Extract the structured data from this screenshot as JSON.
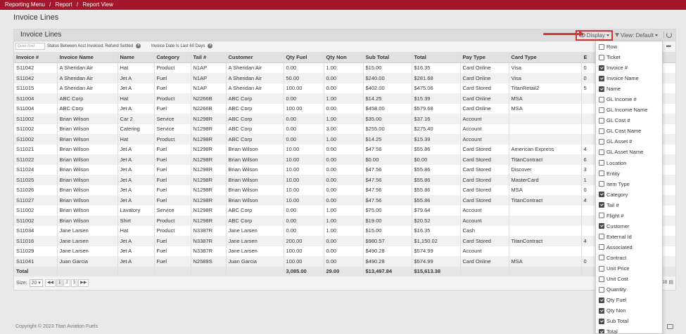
{
  "breadcrumb": [
    "Reporting Menu",
    "/",
    "Report",
    "/",
    "Report View"
  ],
  "page_title": "Invoice Lines",
  "panel": {
    "title": "Invoice Lines",
    "display_label": "Display",
    "view_label": "View: Default"
  },
  "quickfind_placeholder": "Quick Find",
  "filters": [
    "Status Between Acct Invoiced; Refund Settled",
    "Invoice Date Is Last 60 Days"
  ],
  "columns": [
    "Invoice #",
    "Invoice Name",
    "Name",
    "Category",
    "Tail #",
    "Customer",
    "Qty Fuel",
    "Qty Non",
    "Sub Total",
    "Total",
    "Pay Type",
    "Card Type",
    "E"
  ],
  "rows": [
    [
      "S11042",
      "A Sheridan Air",
      "Hat",
      "Product",
      "N1AP",
      "A Sheridan Air",
      "0.00",
      "1.00",
      "$15.00",
      "$16.35",
      "Card Online",
      "Visa",
      "0"
    ],
    [
      "S11042",
      "A Sheridan Air",
      "Jet A",
      "Fuel",
      "N1AP",
      "A Sheridan Air",
      "50.00",
      "0.00",
      "$240.00",
      "$281.68",
      "Card Online",
      "Visa",
      "0"
    ],
    [
      "S11015",
      "A Sheridan Air",
      "Jet A",
      "Fuel",
      "N1AP",
      "A Sheridan Air",
      "100.00",
      "0.00",
      "$402.00",
      "$475.06",
      "Card Stored",
      "TitanRetail2",
      "5"
    ],
    [
      "S11004",
      "ABC Corp",
      "Hat",
      "Product",
      "N2266B",
      "ABC Corp",
      "0.00",
      "1.00",
      "$14.25",
      "$15.39",
      "Card Online",
      "MSA",
      ""
    ],
    [
      "S11004",
      "ABC Corp",
      "Jet A",
      "Fuel",
      "N2266B",
      "ABC Corp",
      "100.00",
      "0.00",
      "$458.00",
      "$579.68",
      "Card Online",
      "MSA",
      ""
    ],
    [
      "S11002",
      "Brian Wilson",
      "Car 2",
      "Service",
      "N1298R",
      "ABC Corp",
      "0.00",
      "1.00",
      "$35.00",
      "$37.16",
      "Account",
      "",
      ""
    ],
    [
      "S11002",
      "Brian Wilson",
      "Catering",
      "Service",
      "N1298R",
      "ABC Corp",
      "0.00",
      "3.00",
      "$255.00",
      "$275.40",
      "Account",
      "",
      ""
    ],
    [
      "S11002",
      "Brian Wilson",
      "Hat",
      "Product",
      "N1298R",
      "ABC Corp",
      "0.00",
      "1.00",
      "$14.25",
      "$15.39",
      "Account",
      "",
      ""
    ],
    [
      "S11021",
      "Brian Wilson",
      "Jet A",
      "Fuel",
      "N1298R",
      "Brian Wilson",
      "10.00",
      "0.00",
      "$47.56",
      "$55.86",
      "Card Stored",
      "American Express",
      "4"
    ],
    [
      "S11022",
      "Brian Wilson",
      "Jet A",
      "Fuel",
      "N1298R",
      "Brian Wilson",
      "10.00",
      "0.00",
      "$0.00",
      "$0.00",
      "Card Stored",
      "TitanContract",
      "6"
    ],
    [
      "S11024",
      "Brian Wilson",
      "Jet A",
      "Fuel",
      "N1298R",
      "Brian Wilson",
      "10.00",
      "0.00",
      "$47.56",
      "$55.86",
      "Card Stored",
      "Discover",
      "3"
    ],
    [
      "S11025",
      "Brian Wilson",
      "Jet A",
      "Fuel",
      "N1298R",
      "Brian Wilson",
      "10.00",
      "0.00",
      "$47.56",
      "$55.86",
      "Card Stored",
      "MasterCard",
      "1"
    ],
    [
      "S11026",
      "Brian Wilson",
      "Jet A",
      "Fuel",
      "N1298R",
      "Brian Wilson",
      "10.00",
      "0.00",
      "$47.56",
      "$55.86",
      "Card Stored",
      "MSA",
      "0"
    ],
    [
      "S11027",
      "Brian Wilson",
      "Jet A",
      "Fuel",
      "N1298R",
      "Brian Wilson",
      "10.00",
      "0.00",
      "$47.56",
      "$55.86",
      "Card Stored",
      "TitanContract",
      "4"
    ],
    [
      "S11002",
      "Brian Wilson",
      "Lavatory",
      "Service",
      "N1298R",
      "ABC Corp",
      "0.00",
      "1.00",
      "$75.00",
      "$79.64",
      "Account",
      "",
      ""
    ],
    [
      "S11002",
      "Brian Wilson",
      "Shirt",
      "Product",
      "N1298R",
      "ABC Corp",
      "0.00",
      "1.00",
      "$19.00",
      "$20.52",
      "Account",
      "",
      ""
    ],
    [
      "S11034",
      "Jane Larsen",
      "Hat",
      "Product",
      "N3387R",
      "Jane Larsen",
      "0.00",
      "1.00",
      "$15.00",
      "$16.35",
      "Cash",
      "",
      ""
    ],
    [
      "S11016",
      "Jane Larsen",
      "Jet A",
      "Fuel",
      "N3387R",
      "Jane Larsen",
      "200.00",
      "0.00",
      "$980.57",
      "$1,150.02",
      "Card Stored",
      "TitanContract",
      "4"
    ],
    [
      "S11029",
      "Jane Larsen",
      "Jet A",
      "Fuel",
      "N3387R",
      "Jane Larsen",
      "100.00",
      "0.00",
      "$490.28",
      "$574.99",
      "Account",
      "",
      ""
    ],
    [
      "S11041",
      "Juan Garcia",
      "Jet A",
      "Fuel",
      "N2589S",
      "Juan Garcia",
      "100.00",
      "0.00",
      "$490.28",
      "$574.99",
      "Card Online",
      "MSA",
      "0"
    ]
  ],
  "totals": [
    "Total",
    "",
    "",
    "",
    "",
    "",
    "3,085.00",
    "29.00",
    "$13,497.84",
    "$15,613.38",
    "",
    "",
    ""
  ],
  "pager": {
    "size_label": "Size:",
    "size_value": "20",
    "pages": [
      "1",
      "2",
      "3"
    ],
    "record_count": "58"
  },
  "display_options": [
    {
      "label": "Row",
      "checked": false
    },
    {
      "label": "Ticket",
      "checked": false
    },
    {
      "label": "Invoice #",
      "checked": true
    },
    {
      "label": "Invoice Name",
      "checked": true
    },
    {
      "label": "Name",
      "checked": true
    },
    {
      "label": "GL Income #",
      "checked": false
    },
    {
      "label": "GL Income Name",
      "checked": false
    },
    {
      "label": "GL Cost #",
      "checked": false
    },
    {
      "label": "GL Cost Name",
      "checked": false
    },
    {
      "label": "GL Asset #",
      "checked": false
    },
    {
      "label": "GL Asset Name",
      "checked": false
    },
    {
      "label": "Location",
      "checked": false
    },
    {
      "label": "Entity",
      "checked": false
    },
    {
      "label": "Item Type",
      "checked": false
    },
    {
      "label": "Category",
      "checked": true
    },
    {
      "label": "Tail #",
      "checked": true
    },
    {
      "label": "Flight #",
      "checked": false
    },
    {
      "label": "Customer",
      "checked": true
    },
    {
      "label": "External Id",
      "checked": false
    },
    {
      "label": "Associated",
      "checked": false
    },
    {
      "label": "Contract",
      "checked": false
    },
    {
      "label": "Unit Price",
      "checked": false
    },
    {
      "label": "Unit Cost",
      "checked": false
    },
    {
      "label": "Quantity",
      "checked": false
    },
    {
      "label": "Qty Fuel",
      "checked": true
    },
    {
      "label": "Qty Non",
      "checked": true
    },
    {
      "label": "Sub Total",
      "checked": true
    },
    {
      "label": "Total",
      "checked": true
    }
  ],
  "footer": "Copyright © 2023 Titan Aviation Fuels",
  "colors": {
    "brand": "#a4162c",
    "highlight": "#d23434"
  }
}
